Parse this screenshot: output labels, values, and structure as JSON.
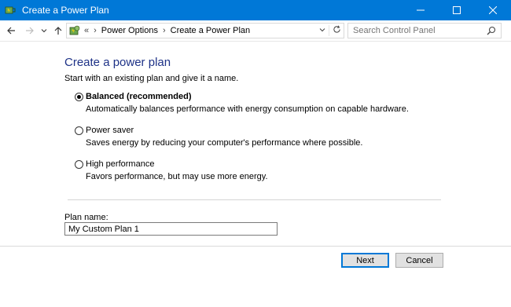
{
  "window": {
    "title": "Create a Power Plan",
    "controls": {
      "minimize": "—",
      "maximize": "☐",
      "close": "✕"
    }
  },
  "navbar": {
    "back_icon": "arrow-left-icon",
    "forward_icon": "arrow-right-icon",
    "recent_icon": "chevron-down-icon",
    "up_icon": "arrow-up-icon",
    "overflow": "«",
    "breadcrumbs": [
      "Power Options",
      "Create a Power Plan"
    ],
    "separator": "›",
    "search_placeholder": "Search Control Panel"
  },
  "main": {
    "heading": "Create a power plan",
    "subtext": "Start with an existing plan and give it a name.",
    "options": [
      {
        "label": "Balanced (recommended)",
        "description": "Automatically balances performance with energy consumption on capable hardware.",
        "selected": true
      },
      {
        "label": "Power saver",
        "description": "Saves energy by reducing your computer's performance where possible.",
        "selected": false
      },
      {
        "label": "High performance",
        "description": "Favors performance, but may use more energy.",
        "selected": false
      }
    ],
    "plan_name_label": "Plan name:",
    "plan_name_value": "My Custom Plan 1"
  },
  "footer": {
    "next_label": "Next",
    "cancel_label": "Cancel"
  },
  "colors": {
    "titlebar": "#0078d7",
    "heading": "#1e3287"
  }
}
